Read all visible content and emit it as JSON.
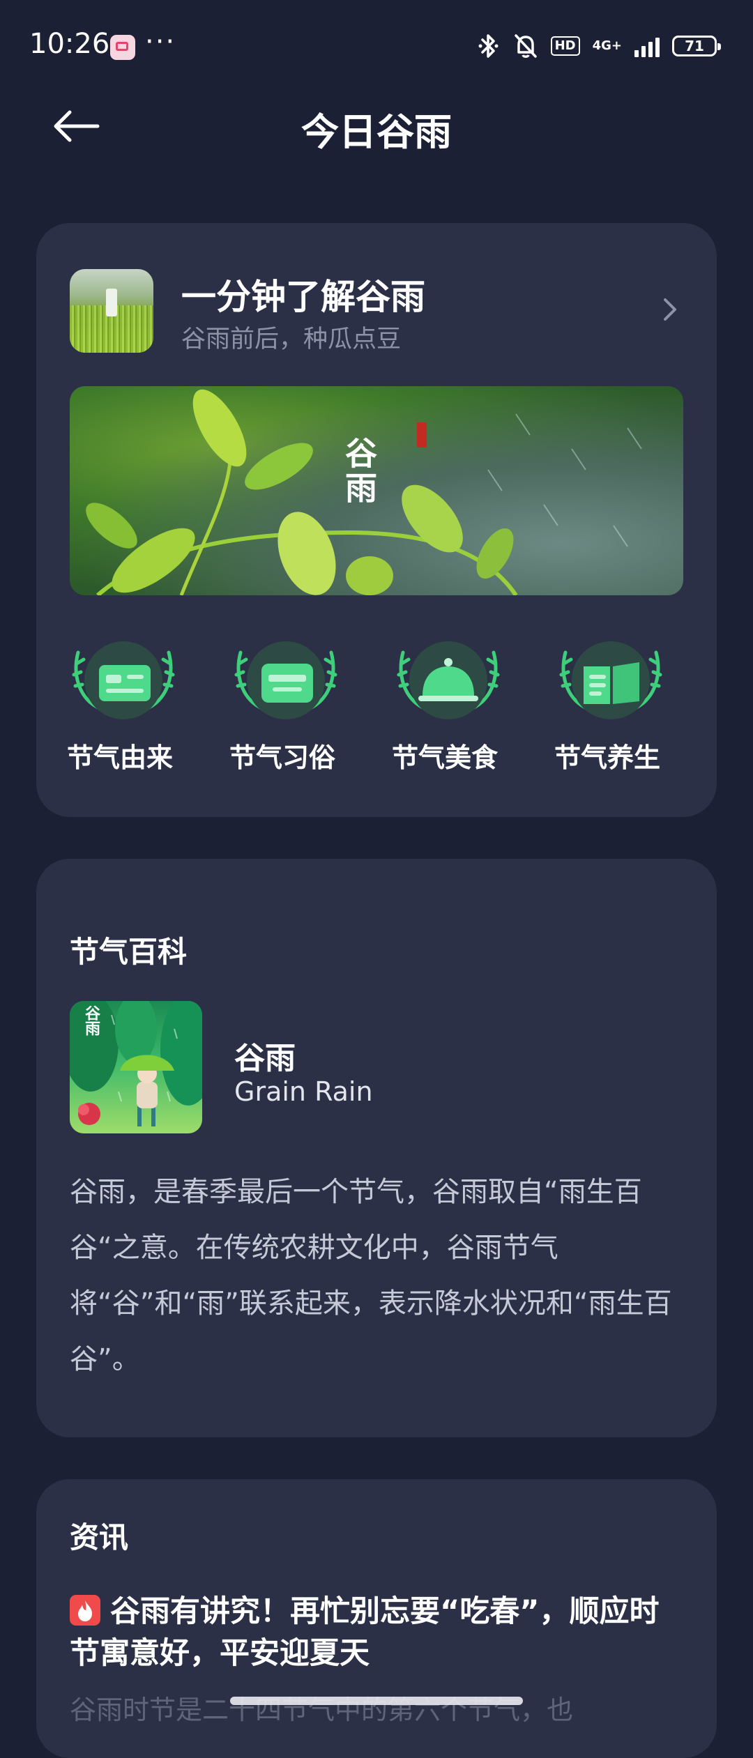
{
  "status_bar": {
    "time": "10:26",
    "dots": "···",
    "network": "4G+",
    "hd": "HD",
    "battery": "71",
    "icons": [
      "bluetooth-icon",
      "bell-off-icon",
      "signal-icon",
      "battery-icon"
    ]
  },
  "header": {
    "title": "今日谷雨",
    "back_icon": "arrow-left-icon"
  },
  "intro": {
    "title": "一分钟了解谷雨",
    "subtitle": "谷雨前后，种瓜点豆",
    "banner_text": "谷雨"
  },
  "categories": [
    {
      "label": "节气由来",
      "icon": "origin-card-icon"
    },
    {
      "label": "节气习俗",
      "icon": "custom-card-icon"
    },
    {
      "label": "节气美食",
      "icon": "food-dome-icon"
    },
    {
      "label": "节气养生",
      "icon": "health-book-icon"
    }
  ],
  "encyclopedia": {
    "section_title": "节气百科",
    "name": "谷雨",
    "english": "Grain Rain",
    "image_text": "谷雨",
    "description": "谷雨，是春季最后一个节气，谷雨取自“雨生百谷“之意。在传统农耕文化中，谷雨节气将“谷”和“雨”联系起来，表示降水状况和“雨生百谷”。"
  },
  "news": {
    "section_title": "资讯",
    "headline": "谷雨有讲究！再忙别忘要“吃春”，顺应时节寓意好，平安迎夏天",
    "snippet": "谷雨时节是二十四节气中的第六个节气，也"
  },
  "colors": {
    "background": "#1c2035",
    "card": "#2b3047",
    "accent_green": "#3ecf7a",
    "fire_red": "#f04a4a"
  }
}
